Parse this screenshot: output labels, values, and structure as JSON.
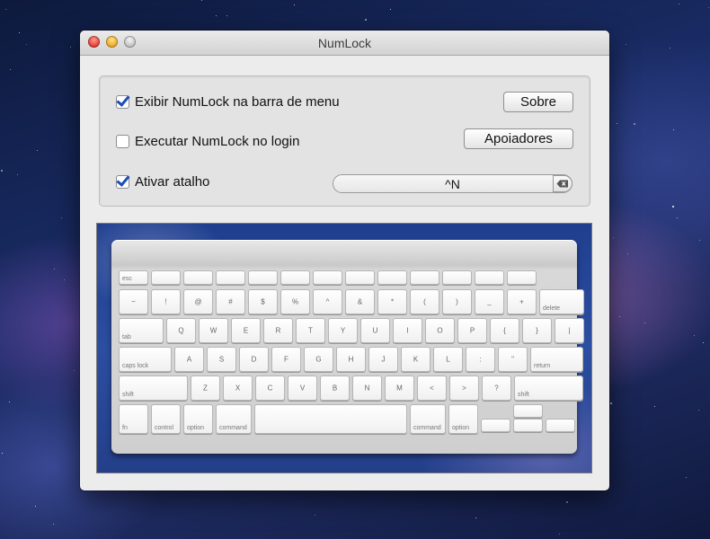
{
  "window": {
    "title": "NumLock"
  },
  "options": {
    "show_in_menubar": {
      "label": "Exibir NumLock na barra de menu",
      "checked": true
    },
    "run_at_login": {
      "label": "Executar NumLock no login",
      "checked": false
    },
    "enable_shortcut": {
      "label": "Ativar atalho",
      "checked": true
    }
  },
  "buttons": {
    "about": "Sobre",
    "supporters": "Apoiadores"
  },
  "shortcut": {
    "value": "^N",
    "clear_icon": "clear-icon"
  },
  "keyboard": {
    "row1": [
      "esc",
      "",
      "",
      "",
      "",
      "",
      "",
      "",
      "",
      "",
      "",
      "",
      ""
    ],
    "row2": [
      "~",
      "!",
      "@",
      "#",
      "$",
      "%",
      "^",
      "&",
      "*",
      "(",
      ")",
      "_",
      "+",
      "delete"
    ],
    "row3": [
      "tab",
      "Q",
      "W",
      "E",
      "R",
      "T",
      "Y",
      "U",
      "I",
      "O",
      "P",
      "{",
      "}",
      "|"
    ],
    "row4": [
      "caps lock",
      "A",
      "S",
      "D",
      "F",
      "G",
      "H",
      "J",
      "K",
      "L",
      ":",
      "\"",
      "return"
    ],
    "row5": [
      "shift",
      "Z",
      "X",
      "C",
      "V",
      "B",
      "N",
      "M",
      "<",
      ">",
      "?",
      "shift"
    ],
    "row6": [
      "fn",
      "control",
      "option",
      "command",
      "",
      "command",
      "option"
    ]
  }
}
